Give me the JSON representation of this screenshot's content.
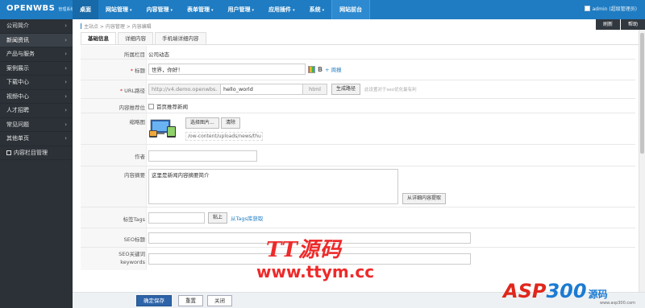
{
  "app": {
    "brand": "OPENWBS",
    "subtitle": "管理系统"
  },
  "topnav": [
    {
      "label": "桌面",
      "caret": false
    },
    {
      "label": "网站管理",
      "caret": true
    },
    {
      "label": "内容管理",
      "caret": true
    },
    {
      "label": "表单管理",
      "caret": true
    },
    {
      "label": "用户管理",
      "caret": true
    },
    {
      "label": "应用插件",
      "caret": true
    },
    {
      "label": "系统",
      "caret": true
    },
    {
      "label": "网站前台",
      "caret": false
    }
  ],
  "user": {
    "label": "admin (超级管理员)"
  },
  "sidebar": {
    "items": [
      {
        "label": "公司简介"
      },
      {
        "label": "新闻资讯"
      },
      {
        "label": "产品与服务"
      },
      {
        "label": "案例展示"
      },
      {
        "label": "下载中心"
      },
      {
        "label": "视频中心"
      },
      {
        "label": "人才招聘"
      },
      {
        "label": "常见问题"
      },
      {
        "label": "其他单页"
      },
      {
        "label": "内容栏目管理"
      }
    ]
  },
  "breadcrumb": "主站点 > 内容管理 > 内容编辑",
  "quick": {
    "refresh": "刷新",
    "help": "帮助"
  },
  "tabs": [
    {
      "label": "基础信息"
    },
    {
      "label": "详细内容"
    },
    {
      "label": "手机端详细内容"
    }
  ],
  "form": {
    "category": {
      "label": "所属栏目",
      "value": "公司动态"
    },
    "title": {
      "label": "标题",
      "value": "世界，你好！",
      "bold": "B",
      "more": "+ 周报"
    },
    "url": {
      "label": "URL路径",
      "prefix": "http://v4.demo.openwbs.c",
      "value": "hello_world",
      "suffix": "html",
      "generate": "生成路径",
      "hint": "此设置对于seo优化最有利"
    },
    "recommend": {
      "label": "内容推荐位",
      "option": "首页推荐新闻"
    },
    "thumb": {
      "label": "缩略图",
      "choose": "选择图片...",
      "clear": "清除",
      "path": "/ow-content/uploads/news/thu"
    },
    "author": {
      "label": "作者",
      "value": ""
    },
    "summary": {
      "label": "内容摘要",
      "value": "这里是新闻内容摘要简介",
      "extract": "从详细内容提取"
    },
    "tags": {
      "label": "标签Tags",
      "paste": "粘上",
      "link": "从Tags库获取"
    },
    "seo_title": {
      "label": "SEO标题"
    },
    "seo_keywords": {
      "label1": "SEO关键词",
      "label2": "keywords"
    }
  },
  "buttons": {
    "save": "确定保存",
    "reset": "重置",
    "close": "关闭"
  },
  "watermark": {
    "line1": "TT源码",
    "line2": "www.ttym.cc",
    "asp_a": "ASP",
    "asp_b": "300",
    "asp_c": "源码",
    "asp_d": "www.asp300.com"
  }
}
